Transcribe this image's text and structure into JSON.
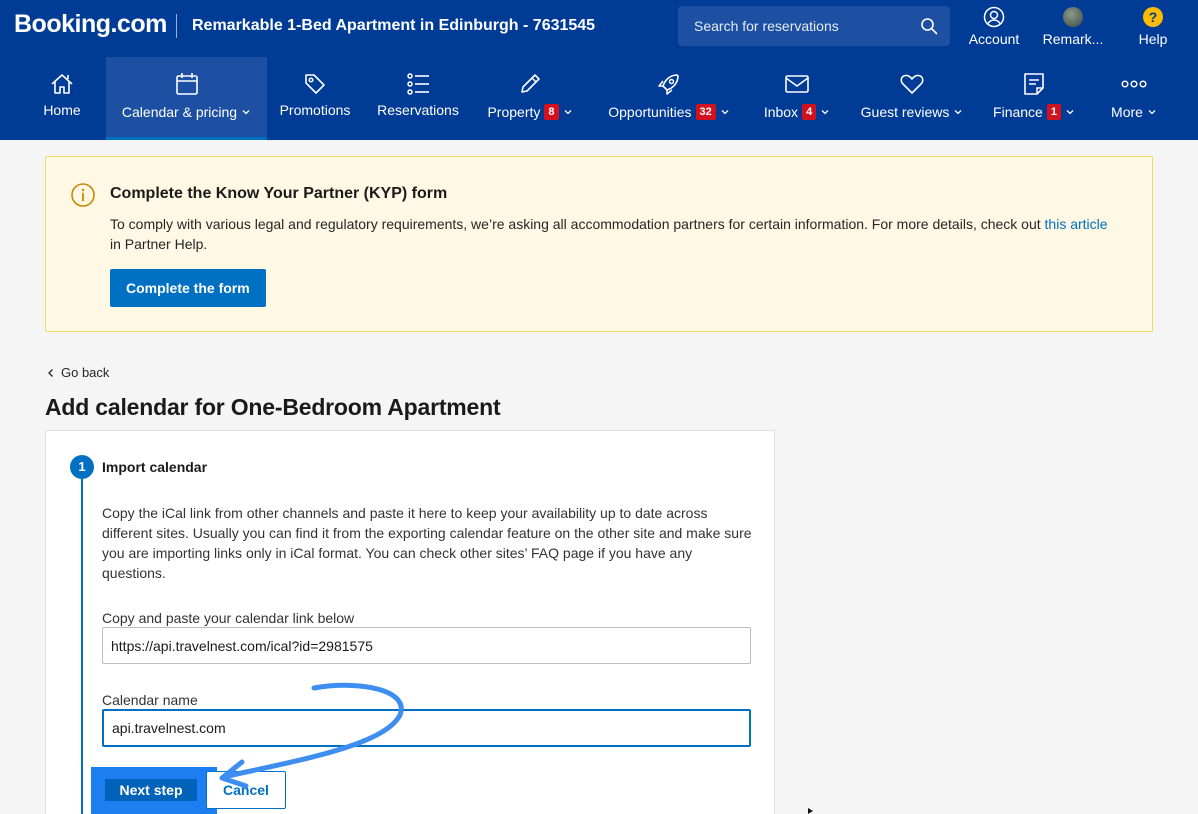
{
  "header": {
    "brand": "Booking.com",
    "property_title": "Remarkable 1-Bed Apartment in Edinburgh - 7631545",
    "search_placeholder": "Search for reservations",
    "actions": {
      "account": "Account",
      "profile": "Remark...",
      "help": "Help",
      "help_symbol": "?"
    }
  },
  "nav": {
    "home": "Home",
    "calendar": "Calendar & pricing",
    "promotions": "Promotions",
    "reservations": "Reservations",
    "property": "Property",
    "property_badge": "8",
    "opportunities": "Opportunities",
    "opportunities_badge": "32",
    "inbox": "Inbox",
    "inbox_badge": "4",
    "guest_reviews": "Guest reviews",
    "finance": "Finance",
    "finance_badge": "1",
    "more": "More"
  },
  "banner": {
    "title": "Complete the Know Your Partner (KYP) form",
    "text_before": "To comply with various legal and regulatory requirements, we’re asking all accommodation partners for certain information. For more details, check out ",
    "link_text": "this article",
    "text_after": " in Partner Help.",
    "button": "Complete the form"
  },
  "page": {
    "go_back": "Go back",
    "title": "Add calendar for One-Bedroom Apartment"
  },
  "step": {
    "number": "1",
    "title": "Import calendar",
    "description": "Copy the iCal link from other channels and paste it here to keep your availability up to date across different sites. Usually you can find it from the exporting calendar feature on the other site and make sure you are importing links only in iCal format. You can check other sites’ FAQ page if you have any questions.",
    "link_label": "Copy and paste your calendar link below",
    "link_value": "https://api.travelnest.com/ical?id=2981575",
    "name_label": "Calendar name",
    "name_value": "api.travelnest.com",
    "next_button": "Next step",
    "cancel_button": "Cancel"
  },
  "colors": {
    "header_bg": "#003b95",
    "active_tab": "#1d4fa3",
    "accent": "#0071c2",
    "badge": "#d4111e",
    "banner_bg": "#fef8e4",
    "annotation": "#3d8ef0"
  },
  "icons": [
    "search-icon",
    "account-icon",
    "avatar",
    "help-icon",
    "home-icon",
    "calendar-icon",
    "tag-icon",
    "list-icon",
    "pencil-icon",
    "rocket-icon",
    "envelope-icon",
    "heart-icon",
    "document-icon",
    "more-icon",
    "info-icon",
    "chevron-left-icon",
    "chevron-down-icon"
  ]
}
